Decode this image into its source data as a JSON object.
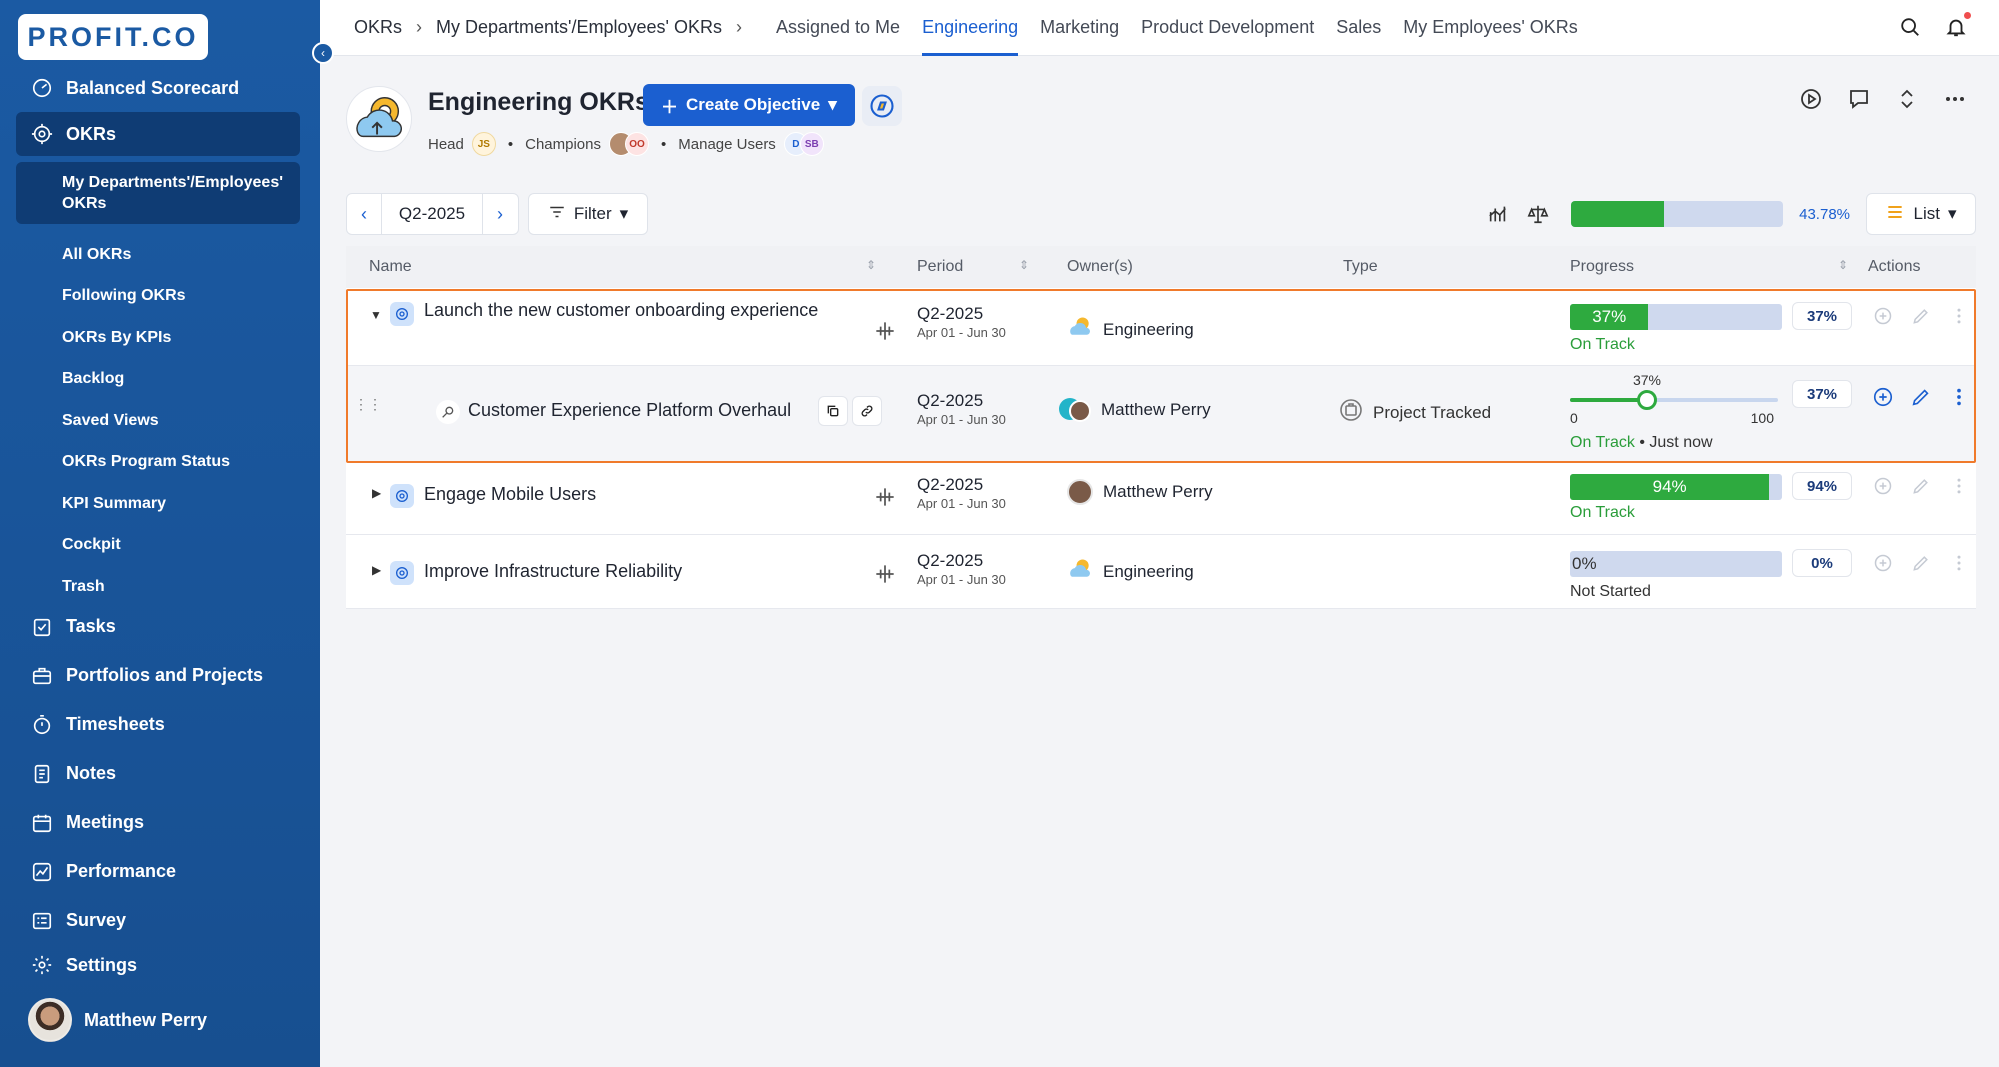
{
  "brand": {
    "logo_text": "PROFIT.CO"
  },
  "sidebar": {
    "top_items": [
      {
        "label": "Balanced Scorecard",
        "icon": "scorecard-icon"
      },
      {
        "label": "OKRs",
        "icon": "target-icon"
      }
    ],
    "okr_sub_active": "My Departments'/Employees' OKRs",
    "okr_sub": [
      "All OKRs",
      "Following OKRs",
      "OKRs By KPIs",
      "Backlog",
      "Saved Views",
      "OKRs Program Status",
      "KPI Summary",
      "Cockpit",
      "Trash"
    ],
    "bottom_items": [
      {
        "label": "Tasks",
        "icon": "tasks-icon"
      },
      {
        "label": "Portfolios and Projects",
        "icon": "briefcase-icon"
      },
      {
        "label": "Timesheets",
        "icon": "stopwatch-icon"
      },
      {
        "label": "Notes",
        "icon": "notes-icon"
      },
      {
        "label": "Meetings",
        "icon": "calendar-icon"
      },
      {
        "label": "Performance",
        "icon": "performance-icon"
      },
      {
        "label": "Survey",
        "icon": "survey-icon"
      }
    ],
    "settings": "Settings",
    "user": "Matthew Perry"
  },
  "topbar": {
    "crumb1": "OKRs",
    "crumb2": "My Departments'/Employees' OKRs",
    "tabs": [
      "Assigned to Me",
      "Engineering",
      "Marketing",
      "Product Development",
      "Sales",
      "My Employees' OKRs"
    ],
    "active_tab": "Engineering"
  },
  "header": {
    "title": "Engineering OKRs",
    "create_label": "Create Objective",
    "head_label": "Head",
    "head_chip": "JS",
    "champions_label": "Champions",
    "champion_chip": "OO",
    "manage_label": "Manage Users",
    "manage_chip1": "D",
    "manage_chip2": "SB"
  },
  "toolbar": {
    "period": "Q2-2025",
    "filter_label": "Filter",
    "overall_progress": 43.78,
    "overall_label": "43.78%",
    "view_label": "List"
  },
  "table": {
    "headers": {
      "name": "Name",
      "period": "Period",
      "owners": "Owner(s)",
      "type": "Type",
      "progress": "Progress",
      "actions": "Actions"
    },
    "rows": [
      {
        "name": "Launch the new customer onboarding experience",
        "period": "Q2-2025",
        "range": "Apr 01 - Jun 30",
        "owner": "Engineering",
        "progress": 37,
        "progress_label": "37%",
        "status": "On Track"
      },
      {
        "name": "Customer Experience Platform Overhaul",
        "period": "Q2-2025",
        "range": "Apr 01 - Jun 30",
        "owner": "Matthew Perry",
        "type": "Project Tracked",
        "progress": 37,
        "progress_label": "37%",
        "min": "0",
        "max": "100",
        "status": "On Track",
        "status_suffix": "• Just now"
      },
      {
        "name": "Engage Mobile Users",
        "period": "Q2-2025",
        "range": "Apr 01 - Jun 30",
        "owner": "Matthew Perry",
        "progress": 94,
        "progress_label": "94%",
        "status": "On Track"
      },
      {
        "name": "Improve Infrastructure Reliability",
        "period": "Q2-2025",
        "range": "Apr 01 - Jun 30",
        "owner": "Engineering",
        "progress": 0,
        "progress_label": "0%",
        "status": "Not Started"
      }
    ]
  },
  "colors": {
    "brand": "#1b5aa3",
    "accent": "#1b5fd0",
    "green": "#2eaa3f",
    "highlight": "#f07a2b"
  }
}
